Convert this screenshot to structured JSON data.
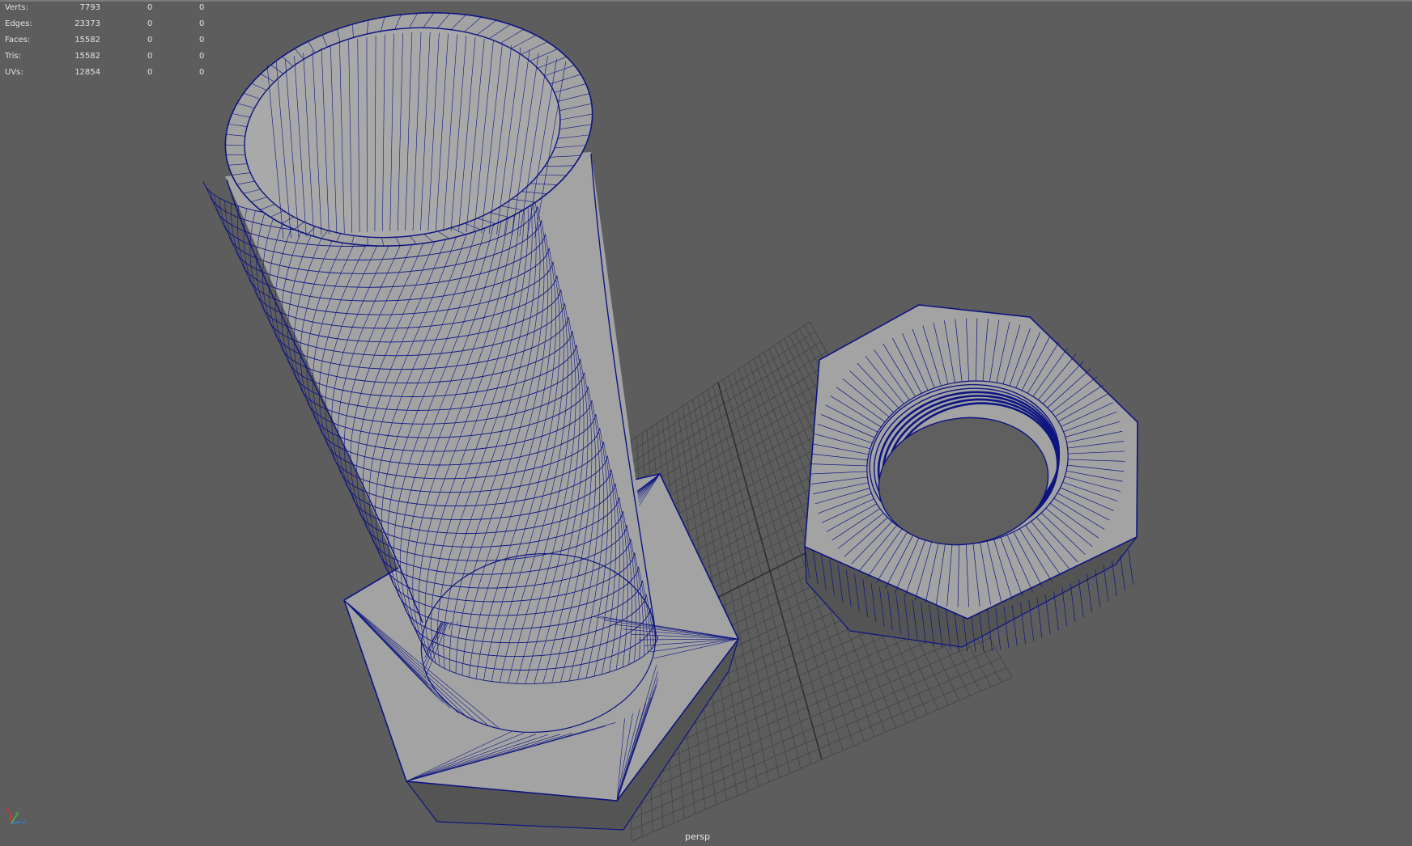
{
  "hud": {
    "rows": [
      {
        "label": "Verts:",
        "total": "7793",
        "selected": "0",
        "component": "0"
      },
      {
        "label": "Edges:",
        "total": "23373",
        "selected": "0",
        "component": "0"
      },
      {
        "label": "Faces:",
        "total": "15582",
        "selected": "0",
        "component": "0"
      },
      {
        "label": "Tris:",
        "total": "15582",
        "selected": "0",
        "component": "0"
      },
      {
        "label": "UVs:",
        "total": "12854",
        "selected": "0",
        "component": "0"
      }
    ]
  },
  "camera": {
    "name": "persp"
  },
  "axis": {
    "x": "x",
    "y": "y",
    "z": "z"
  },
  "colors": {
    "background": "#5d5d5d",
    "mesh_fill": "#a3a3a3",
    "mesh_shadow": "#545454",
    "wire": "#0d1580",
    "grid": "#444444",
    "grid_axis": "#2e2e2e",
    "hud_text": "#e2e2e2"
  }
}
